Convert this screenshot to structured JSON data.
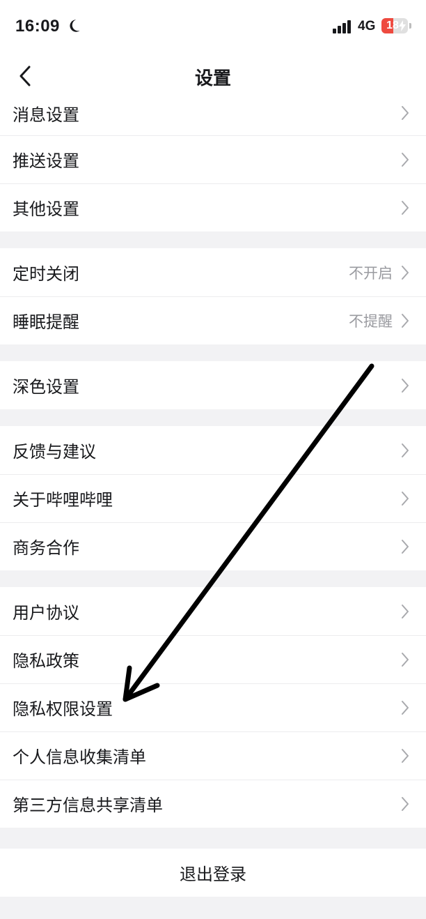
{
  "status_bar": {
    "time": "16:09",
    "network": "4G",
    "battery": "18",
    "battery_level": 0.18,
    "moon_icon": "moon-icon",
    "signal_icon": "signal-icon",
    "bolt_icon": "charging-bolt-icon"
  },
  "header": {
    "title": "设置",
    "back_icon": "chevron-left-icon"
  },
  "groups": [
    {
      "items": [
        {
          "label": "消息设置"
        },
        {
          "label": "推送设置"
        },
        {
          "label": "其他设置"
        }
      ]
    },
    {
      "items": [
        {
          "label": "定时关闭",
          "value": "不开启"
        },
        {
          "label": "睡眠提醒",
          "value": "不提醒"
        }
      ]
    },
    {
      "items": [
        {
          "label": "深色设置"
        }
      ]
    },
    {
      "items": [
        {
          "label": "反馈与建议"
        },
        {
          "label": "关于哔哩哔哩"
        },
        {
          "label": "商务合作"
        }
      ]
    },
    {
      "items": [
        {
          "label": "用户协议"
        },
        {
          "label": "隐私政策"
        },
        {
          "label": "隐私权限设置"
        },
        {
          "label": "个人信息收集清单"
        },
        {
          "label": "第三方信息共享清单"
        }
      ]
    }
  ],
  "logout": {
    "label": "退出登录"
  },
  "colors": {
    "background": "#f2f2f4",
    "text": "#18191c",
    "secondary_text": "#9a9ba0",
    "battery_low": "#ee4a3f",
    "annotation": "#000000"
  },
  "annotation": {
    "icon": "arrow-annotation-icon",
    "target": "隐私权限设置"
  }
}
